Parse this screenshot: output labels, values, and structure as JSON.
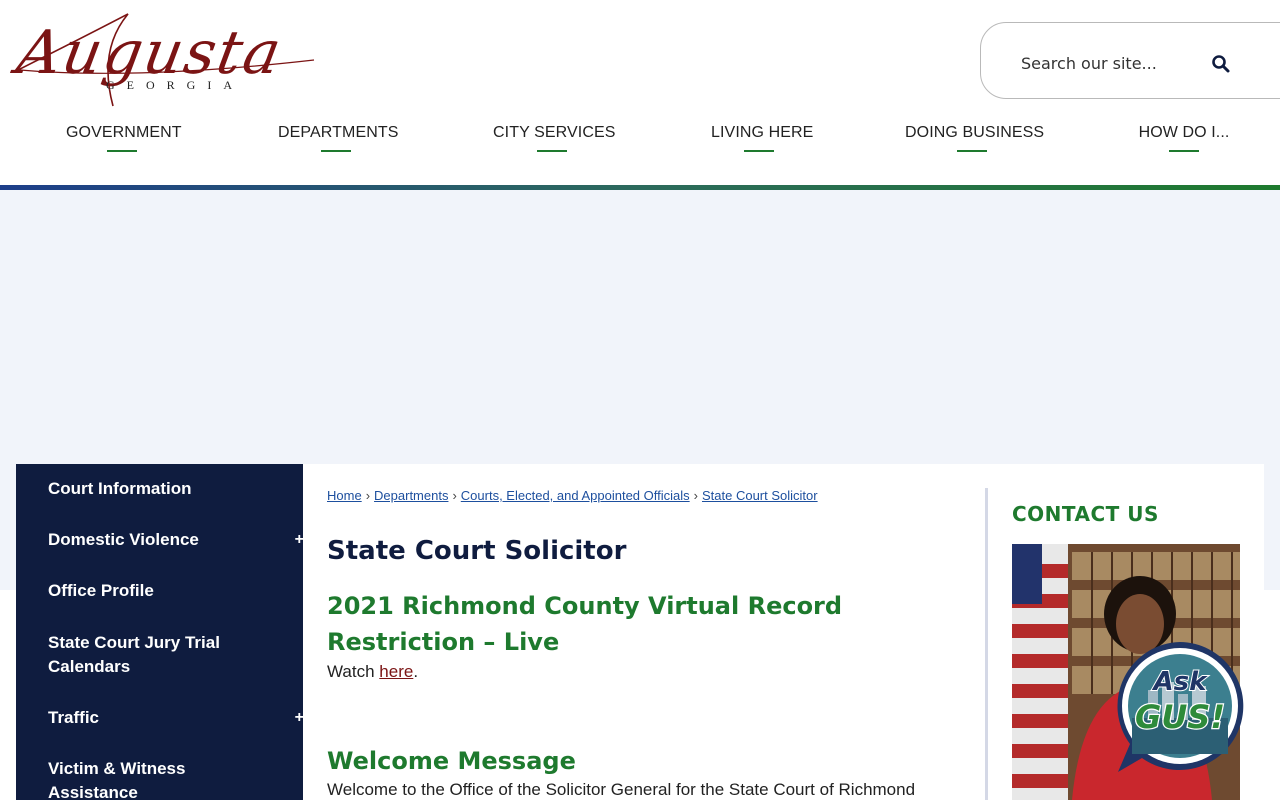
{
  "logo": {
    "script": "Augusta",
    "sub": "GEORGIA"
  },
  "search": {
    "placeholder": "Search our site..."
  },
  "nav": [
    {
      "label": "GOVERNMENT"
    },
    {
      "label": "DEPARTMENTS"
    },
    {
      "label": "CITY SERVICES"
    },
    {
      "label": "LIVING HERE"
    },
    {
      "label": "DOING BUSINESS"
    },
    {
      "label": "HOW DO I..."
    }
  ],
  "sidebar": {
    "items": [
      {
        "label": "Court Information",
        "expandable": false
      },
      {
        "label": "Domestic Violence",
        "expandable": true
      },
      {
        "label": "Office Profile",
        "expandable": false
      },
      {
        "label": "State Court Jury Trial Calendars",
        "expandable": false
      },
      {
        "label": "Traffic",
        "expandable": true
      },
      {
        "label": "Victim & Witness Assistance",
        "expandable": false
      }
    ],
    "expand_symbol": "+"
  },
  "breadcrumb": [
    {
      "label": "Home"
    },
    {
      "label": "Departments"
    },
    {
      "label": "Courts, Elected, and Appointed Officials"
    },
    {
      "label": "State Court Solicitor"
    }
  ],
  "breadcrumb_sep": "›",
  "main": {
    "title": "State Court Solicitor",
    "record_heading": "2021 Richmond County Virtual Record Restriction – Live",
    "watch_prefix": "Watch ",
    "watch_link": "here",
    "watch_suffix": ".",
    "welcome_heading": "Welcome Message",
    "welcome_text": "Welcome to the Office of the Solicitor General for the State Court of Richmond"
  },
  "contact": {
    "title": "CONTACT US"
  },
  "ask_gus": {
    "line1": "Ask",
    "line2": "GUS!"
  },
  "colors": {
    "navy": "#0f1c3f",
    "green": "#1e7a2e",
    "maroon": "#7b1414",
    "link_blue": "#1d4f9e",
    "banner": "#f1f4fa"
  }
}
